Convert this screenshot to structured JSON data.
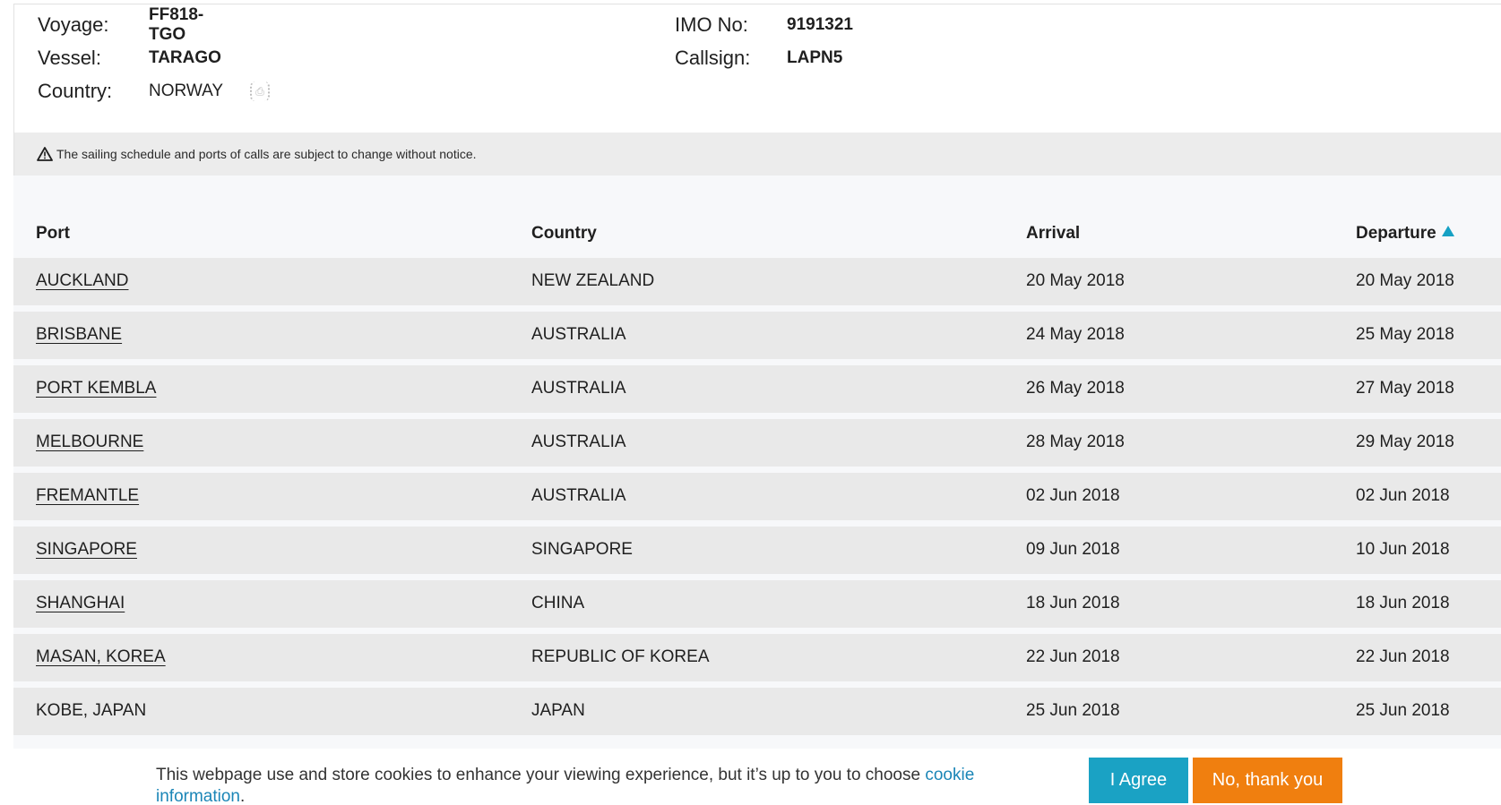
{
  "vessel_info": {
    "voyage_label": "Voyage:",
    "voyage_value": "FF818-TGO",
    "vessel_label": "Vessel:",
    "vessel_value": "TARAGO",
    "country_label": "Country:",
    "country_value": "NORWAY",
    "imo_label": "IMO No:",
    "imo_value": "9191321",
    "callsign_label": "Callsign:",
    "callsign_value": "LAPN5"
  },
  "notice": {
    "icon": "warning-triangle-icon",
    "text": "The sailing schedule and ports of calls are subject to change without notice."
  },
  "schedule": {
    "columns": {
      "port": "Port",
      "country": "Country",
      "arrival": "Arrival",
      "departure": "Departure"
    },
    "sort": {
      "column": "departure",
      "direction": "ascending",
      "color": "#16a1c4"
    },
    "rows": [
      {
        "port": "AUCKLAND",
        "country": "NEW ZEALAND",
        "arrival": "20 May 2018",
        "departure": "20 May 2018"
      },
      {
        "port": "BRISBANE",
        "country": "AUSTRALIA",
        "arrival": "24 May 2018",
        "departure": "25 May 2018"
      },
      {
        "port": "PORT KEMBLA",
        "country": "AUSTRALIA",
        "arrival": "26 May 2018",
        "departure": "27 May 2018"
      },
      {
        "port": "MELBOURNE",
        "country": "AUSTRALIA",
        "arrival": "28 May 2018",
        "departure": "29 May 2018"
      },
      {
        "port": "FREMANTLE",
        "country": "AUSTRALIA",
        "arrival": "02 Jun 2018",
        "departure": "02 Jun 2018"
      },
      {
        "port": "SINGAPORE",
        "country": "SINGAPORE",
        "arrival": "09 Jun 2018",
        "departure": "10 Jun 2018"
      },
      {
        "port": "SHANGHAI",
        "country": "CHINA",
        "arrival": "18 Jun 2018",
        "departure": "18 Jun 2018"
      },
      {
        "port": "MASAN, KOREA",
        "country": "REPUBLIC OF KOREA",
        "arrival": "22 Jun 2018",
        "departure": "22 Jun 2018"
      },
      {
        "port": "KOBE, JAPAN",
        "country": "JAPAN",
        "arrival": "25 Jun 2018",
        "departure": "25 Jun 2018"
      }
    ]
  },
  "cookie_banner": {
    "text": "This webpage use and store cookies to enhance your viewing experience, but it’s up to you to choose ",
    "link_text": "cookie information",
    "trailing": ".",
    "agree_label": "I Agree",
    "decline_label": "No, thank you",
    "agree_color": "#1aa2c4",
    "decline_color": "#f07f0f"
  }
}
